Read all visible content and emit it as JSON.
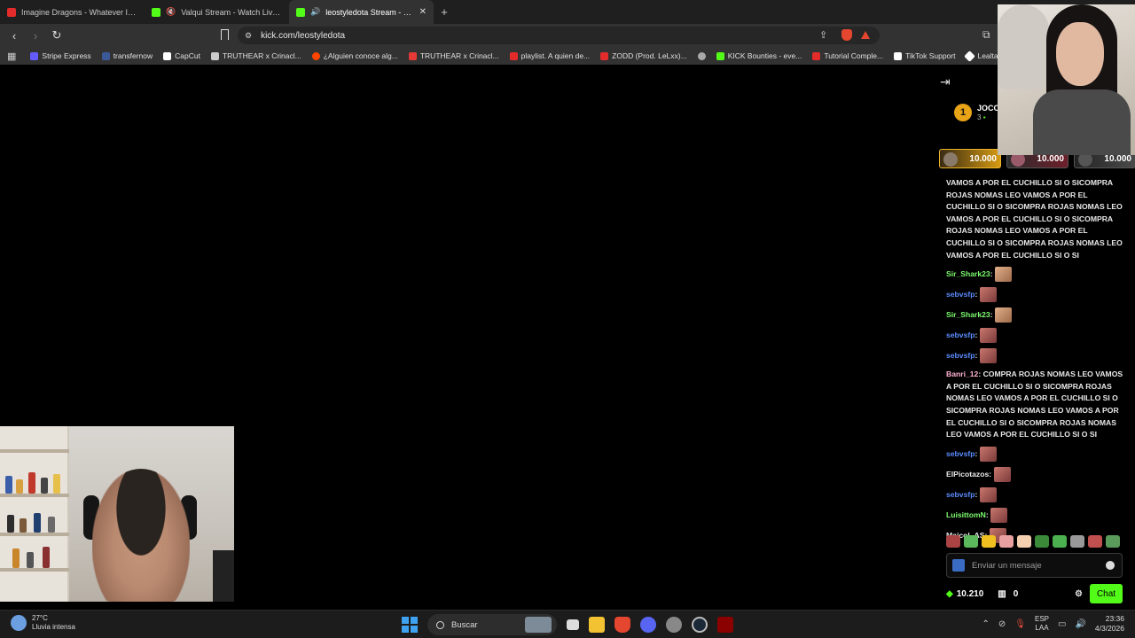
{
  "tabs": [
    {
      "title": "Imagine Dragons - Whatever It Takes",
      "favicon_color": "#e32b2b",
      "active": false
    },
    {
      "title": "Valqui Stream - Watch Live on Kick",
      "favicon_color": "#53fc18",
      "active": false
    },
    {
      "title": "leostyledota Stream - Watch Live",
      "favicon_color": "#53fc18",
      "active": true
    }
  ],
  "url": "kick.com/leostyledota",
  "bookmarks": [
    {
      "label": "Stripe Express",
      "color": "#635bff"
    },
    {
      "label": "transfernow",
      "color": "#3b5998"
    },
    {
      "label": "CapCut",
      "color": "#ffffff"
    },
    {
      "label": "TRUTHEAR x Crinacl...",
      "color": "#cccccc"
    },
    {
      "label": "¿Alguien conoce alg...",
      "color": "#ff4500"
    },
    {
      "label": "TRUTHEAR x Crinacl...",
      "color": "#e53935"
    },
    {
      "label": "playlist. A quien de...",
      "color": "#e32b2b"
    },
    {
      "label": "ZODD (Prod. LeLxx)...",
      "color": "#e32b2b"
    },
    {
      "label": "",
      "color": "#aaaaaa"
    },
    {
      "label": "KICK Bounties - eve...",
      "color": "#53fc18"
    },
    {
      "label": "Tutorial Comple...",
      "color": "#e32b2b"
    },
    {
      "label": "TikTok Support",
      "color": "#ffffff"
    },
    {
      "label": "Lealtad | El mejor",
      "color": "#ffffff"
    }
  ],
  "leaderboard": {
    "rank": "1",
    "name": "JOCC",
    "sub": "3"
  },
  "gifts": [
    "10.000",
    "10.000",
    "10.000"
  ],
  "messages": [
    {
      "user": "",
      "color": "#e9e9e9",
      "text": "VAMOS A POR EL CUCHILLO SI O SICOMPRA ROJAS NOMAS LEO VAMOS A POR EL CUCHILLO SI O SICOMPRA ROJAS NOMAS LEO VAMOS A POR EL CUCHILLO SI O SICOMPRA ROJAS NOMAS LEO VAMOS A POR EL CUCHILLO SI O SICOMPRA ROJAS NOMAS LEO VAMOS A POR EL CUCHILLO SI O SI",
      "emote": ""
    },
    {
      "user": "Sir_Shark23",
      "color": "#7cfc6e",
      "text": "",
      "emote": "shark"
    },
    {
      "user": "sebvsfp",
      "color": "#5b8cff",
      "text": "",
      "emote": "red"
    },
    {
      "user": "Sir_Shark23",
      "color": "#7cfc6e",
      "text": "",
      "emote": "shark"
    },
    {
      "user": "sebvsfp",
      "color": "#5b8cff",
      "text": "",
      "emote": "red"
    },
    {
      "user": "sebvsfp",
      "color": "#5b8cff",
      "text": "",
      "emote": "red"
    },
    {
      "user": "Banri_12",
      "color": "#ffb3d1",
      "text": "COMPRA ROJAS NOMAS LEO VAMOS A POR EL CUCHILLO SI O SICOMPRA ROJAS NOMAS LEO VAMOS A POR EL CUCHILLO SI O SICOMPRA ROJAS NOMAS LEO VAMOS A POR EL CUCHILLO SI O SICOMPRA ROJAS NOMAS LEO VAMOS A POR EL CUCHILLO SI O SI",
      "emote": ""
    },
    {
      "user": "sebvsfp",
      "color": "#5b8cff",
      "text": "",
      "emote": "red"
    },
    {
      "user": "ElPicotazos",
      "color": "#e9e9e9",
      "text": "",
      "emote": "red"
    },
    {
      "user": "sebvsfp",
      "color": "#5b8cff",
      "text": "",
      "emote": "red"
    },
    {
      "user": "LuisittomN",
      "color": "#7cfc6e",
      "text": "",
      "emote": "red"
    },
    {
      "user": "Maicol_AS",
      "color": "#e9e9e9",
      "text": "",
      "emote": "red"
    }
  ],
  "emote_bar": [
    "#a44",
    "#5cb85c",
    "#f0c020",
    "#e8a0a0",
    "#f5d0b0",
    "#3a8a3a",
    "#4caf50",
    "#999",
    "#c0504d",
    "#5a9a5a"
  ],
  "chat_input": {
    "placeholder": "Enviar un mensaje"
  },
  "footer": {
    "points": "10.210",
    "boxes": "0",
    "chat_label": "Chat"
  },
  "taskbar": {
    "weather_temp": "27°C",
    "weather_desc": "Lluvia intensa",
    "search_label": "Buscar",
    "lang_top": "ESP",
    "lang_bottom": "LAA",
    "time": "23:36",
    "date": "4/3/2026"
  }
}
